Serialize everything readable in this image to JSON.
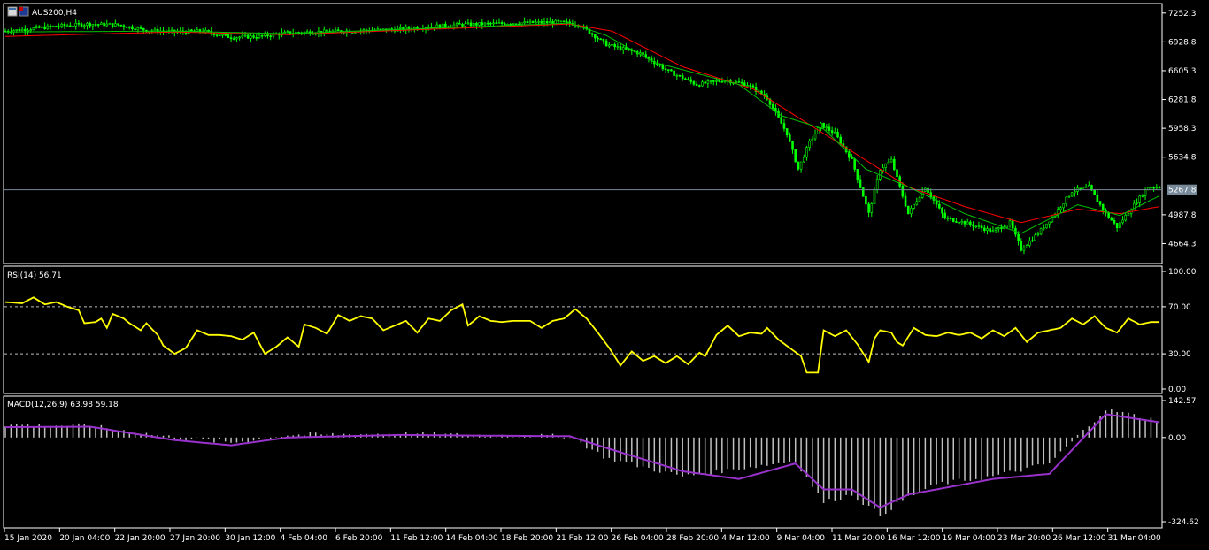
{
  "symbol_label": "AUS200,H4",
  "colors": {
    "background": "#000000",
    "grid_frame": "#ffffff",
    "bull_candle": "#00ff00",
    "ma_fast": "#00c000",
    "ma_slow": "#ff0000",
    "rsi_line": "#ffff00",
    "macd_hist": "#c0c0c0",
    "macd_signal": "#9932cc",
    "price_line": "#778899"
  },
  "icons": [
    "chart-window-icon",
    "symbol-flag-icon"
  ],
  "chart_data": [
    {
      "type": "line",
      "name": "price",
      "title": "AUS200,H4",
      "ylim": [
        4500,
        7300
      ],
      "y_ticks": [
        "7252.3",
        "6928.8",
        "6605.3",
        "6281.8",
        "5958.3",
        "5634.8",
        "4987.8",
        "4664.3"
      ],
      "current_price": 5267.8,
      "current_price_label": "5267.8",
      "x_labels": [
        "15 Jan 2020",
        "20 Jan 04:00",
        "22 Jan 20:00",
        "27 Jan 20:00",
        "30 Jan 12:00",
        "4 Feb 04:00",
        "6 Feb 20:00",
        "11 Feb 12:00",
        "14 Feb 04:00",
        "18 Feb 20:00",
        "21 Feb 12:00",
        "26 Feb 04:00",
        "28 Feb 20:00",
        "4 Mar 12:00",
        "9 Mar 04:00",
        "11 Mar 20:00",
        "16 Mar 12:00",
        "19 Mar 04:00",
        "23 Mar 20:00",
        "26 Mar 12:00",
        "31 Mar 04:00"
      ],
      "close_path": [
        [
          0,
          7050
        ],
        [
          10,
          7080
        ],
        [
          20,
          7110
        ],
        [
          30,
          7130
        ],
        [
          40,
          7120
        ],
        [
          50,
          7060
        ],
        [
          60,
          7040
        ],
        [
          70,
          7050
        ],
        [
          80,
          6980
        ],
        [
          90,
          6990
        ],
        [
          100,
          7030
        ],
        [
          110,
          7040
        ],
        [
          120,
          7050
        ],
        [
          130,
          7060
        ],
        [
          140,
          7070
        ],
        [
          150,
          7100
        ],
        [
          160,
          7120
        ],
        [
          170,
          7130
        ],
        [
          180,
          7140
        ],
        [
          195,
          7150
        ],
        [
          203,
          7130
        ],
        [
          213,
          6900
        ],
        [
          225,
          6800
        ],
        [
          235,
          6600
        ],
        [
          245,
          6450
        ],
        [
          255,
          6500
        ],
        [
          263,
          6450
        ],
        [
          270,
          6300
        ],
        [
          277,
          5900
        ],
        [
          281,
          5500
        ],
        [
          285,
          5800
        ],
        [
          289,
          6000
        ],
        [
          294,
          5900
        ],
        [
          300,
          5600
        ],
        [
          306,
          5000
        ],
        [
          310,
          5500
        ],
        [
          314,
          5600
        ],
        [
          320,
          5000
        ],
        [
          326,
          5300
        ],
        [
          333,
          4950
        ],
        [
          340,
          4900
        ],
        [
          350,
          4800
        ],
        [
          356,
          4900
        ],
        [
          360,
          4600
        ],
        [
          366,
          4780
        ],
        [
          372,
          5000
        ],
        [
          378,
          5250
        ],
        [
          384,
          5300
        ],
        [
          390,
          5000
        ],
        [
          394,
          4850
        ],
        [
          400,
          5100
        ],
        [
          405,
          5300
        ],
        [
          409,
          5300
        ]
      ],
      "ma_fast_path": [
        [
          0,
          7040
        ],
        [
          60,
          7050
        ],
        [
          100,
          7020
        ],
        [
          200,
          7140
        ],
        [
          213,
          7000
        ],
        [
          230,
          6700
        ],
        [
          260,
          6450
        ],
        [
          275,
          6100
        ],
        [
          290,
          5950
        ],
        [
          305,
          5500
        ],
        [
          320,
          5300
        ],
        [
          340,
          5000
        ],
        [
          360,
          4780
        ],
        [
          380,
          5100
        ],
        [
          395,
          4980
        ],
        [
          409,
          5200
        ]
      ],
      "ma_slow_path": [
        [
          0,
          6990
        ],
        [
          60,
          7040
        ],
        [
          100,
          7010
        ],
        [
          200,
          7130
        ],
        [
          215,
          7050
        ],
        [
          240,
          6650
        ],
        [
          265,
          6400
        ],
        [
          280,
          6100
        ],
        [
          300,
          5700
        ],
        [
          320,
          5300
        ],
        [
          340,
          5080
        ],
        [
          360,
          4900
        ],
        [
          380,
          5050
        ],
        [
          395,
          5000
        ],
        [
          409,
          5080
        ]
      ]
    },
    {
      "type": "line",
      "name": "RSI",
      "title": "RSI(14) 56.71",
      "ylim": [
        0,
        100
      ],
      "y_ticks": [
        "100.00",
        "70.00",
        "30.00",
        "0.00"
      ],
      "levels": [
        70,
        30
      ],
      "series": [
        {
          "name": "RSI(14)",
          "values": [
            [
              0,
              74
            ],
            [
              6,
              73
            ],
            [
              10,
              78
            ],
            [
              14,
              72
            ],
            [
              18,
              74
            ],
            [
              22,
              70
            ],
            [
              26,
              67
            ],
            [
              28,
              56
            ],
            [
              32,
              57
            ],
            [
              34,
              60
            ],
            [
              36,
              52
            ],
            [
              38,
              64
            ],
            [
              42,
              60
            ],
            [
              44,
              56
            ],
            [
              48,
              50
            ],
            [
              50,
              56
            ],
            [
              54,
              46
            ],
            [
              56,
              37
            ],
            [
              60,
              30
            ],
            [
              64,
              35
            ],
            [
              68,
              50
            ],
            [
              72,
              46
            ],
            [
              76,
              46
            ],
            [
              80,
              45
            ],
            [
              84,
              42
            ],
            [
              88,
              48
            ],
            [
              92,
              30
            ],
            [
              96,
              36
            ],
            [
              100,
              44
            ],
            [
              104,
              36
            ],
            [
              106,
              55
            ],
            [
              110,
              52
            ],
            [
              114,
              47
            ],
            [
              118,
              63
            ],
            [
              122,
              58
            ],
            [
              126,
              62
            ],
            [
              130,
              60
            ],
            [
              134,
              50
            ],
            [
              138,
              54
            ],
            [
              142,
              58
            ],
            [
              146,
              48
            ],
            [
              150,
              60
            ],
            [
              154,
              58
            ],
            [
              158,
              67
            ],
            [
              162,
              72
            ],
            [
              164,
              54
            ],
            [
              168,
              62
            ],
            [
              172,
              58
            ],
            [
              176,
              57
            ],
            [
              180,
              58
            ],
            [
              186,
              58
            ],
            [
              190,
              52
            ],
            [
              194,
              58
            ],
            [
              198,
              60
            ],
            [
              202,
              68
            ],
            [
              206,
              60
            ],
            [
              210,
              48
            ],
            [
              214,
              35
            ],
            [
              218,
              20
            ],
            [
              222,
              32
            ],
            [
              226,
              24
            ],
            [
              230,
              28
            ],
            [
              234,
              22
            ],
            [
              238,
              28
            ],
            [
              242,
              21
            ],
            [
              246,
              31
            ],
            [
              248,
              28
            ],
            [
              252,
              46
            ],
            [
              256,
              54
            ],
            [
              260,
              45
            ],
            [
              264,
              48
            ],
            [
              268,
              47
            ],
            [
              270,
              52
            ],
            [
              274,
              42
            ],
            [
              278,
              35
            ],
            [
              282,
              28
            ],
            [
              284,
              14
            ],
            [
              288,
              14
            ],
            [
              290,
              50
            ],
            [
              294,
              45
            ],
            [
              298,
              50
            ],
            [
              302,
              38
            ],
            [
              306,
              23
            ],
            [
              308,
              43
            ],
            [
              310,
              50
            ],
            [
              314,
              48
            ],
            [
              316,
              40
            ],
            [
              318,
              37
            ],
            [
              322,
              52
            ],
            [
              326,
              46
            ],
            [
              330,
              45
            ],
            [
              334,
              48
            ],
            [
              338,
              46
            ],
            [
              342,
              48
            ],
            [
              346,
              43
            ],
            [
              350,
              50
            ],
            [
              354,
              45
            ],
            [
              358,
              52
            ],
            [
              362,
              40
            ],
            [
              366,
              48
            ],
            [
              370,
              50
            ],
            [
              374,
              52
            ],
            [
              378,
              60
            ],
            [
              382,
              55
            ],
            [
              386,
              62
            ],
            [
              390,
              52
            ],
            [
              394,
              48
            ],
            [
              398,
              60
            ],
            [
              402,
              55
            ],
            [
              406,
              57
            ],
            [
              409,
              57
            ]
          ]
        }
      ]
    },
    {
      "type": "bar",
      "name": "MACD",
      "title": "MACD(12,26,9) 63.98 59.18",
      "ylim": [
        -324.62,
        142.57
      ],
      "y_ticks": [
        "142.57",
        "0.00",
        "-324.62"
      ],
      "series": [
        {
          "name": "MACD",
          "values": [
            [
              0,
              50
            ],
            [
              30,
              45
            ],
            [
              60,
              0
            ],
            [
              80,
              -20
            ],
            [
              100,
              10
            ],
            [
              140,
              15
            ],
            [
              160,
              10
            ],
            [
              200,
              5
            ],
            [
              213,
              -80
            ],
            [
              240,
              -150
            ],
            [
              260,
              -120
            ],
            [
              280,
              -90
            ],
            [
              290,
              -250
            ],
            [
              300,
              -220
            ],
            [
              310,
              -300
            ],
            [
              320,
              -230
            ],
            [
              330,
              -180
            ],
            [
              350,
              -150
            ],
            [
              370,
              -100
            ],
            [
              390,
              110
            ],
            [
              409,
              64
            ]
          ]
        },
        {
          "name": "Signal",
          "values": [
            [
              0,
              40
            ],
            [
              30,
              42
            ],
            [
              60,
              -10
            ],
            [
              80,
              -30
            ],
            [
              100,
              0
            ],
            [
              140,
              10
            ],
            [
              160,
              8
            ],
            [
              200,
              5
            ],
            [
              213,
              -40
            ],
            [
              240,
              -130
            ],
            [
              260,
              -160
            ],
            [
              280,
              -100
            ],
            [
              290,
              -200
            ],
            [
              300,
              -200
            ],
            [
              310,
              -270
            ],
            [
              320,
              -220
            ],
            [
              330,
              -200
            ],
            [
              350,
              -160
            ],
            [
              370,
              -140
            ],
            [
              390,
              90
            ],
            [
              409,
              59
            ]
          ]
        }
      ]
    }
  ]
}
